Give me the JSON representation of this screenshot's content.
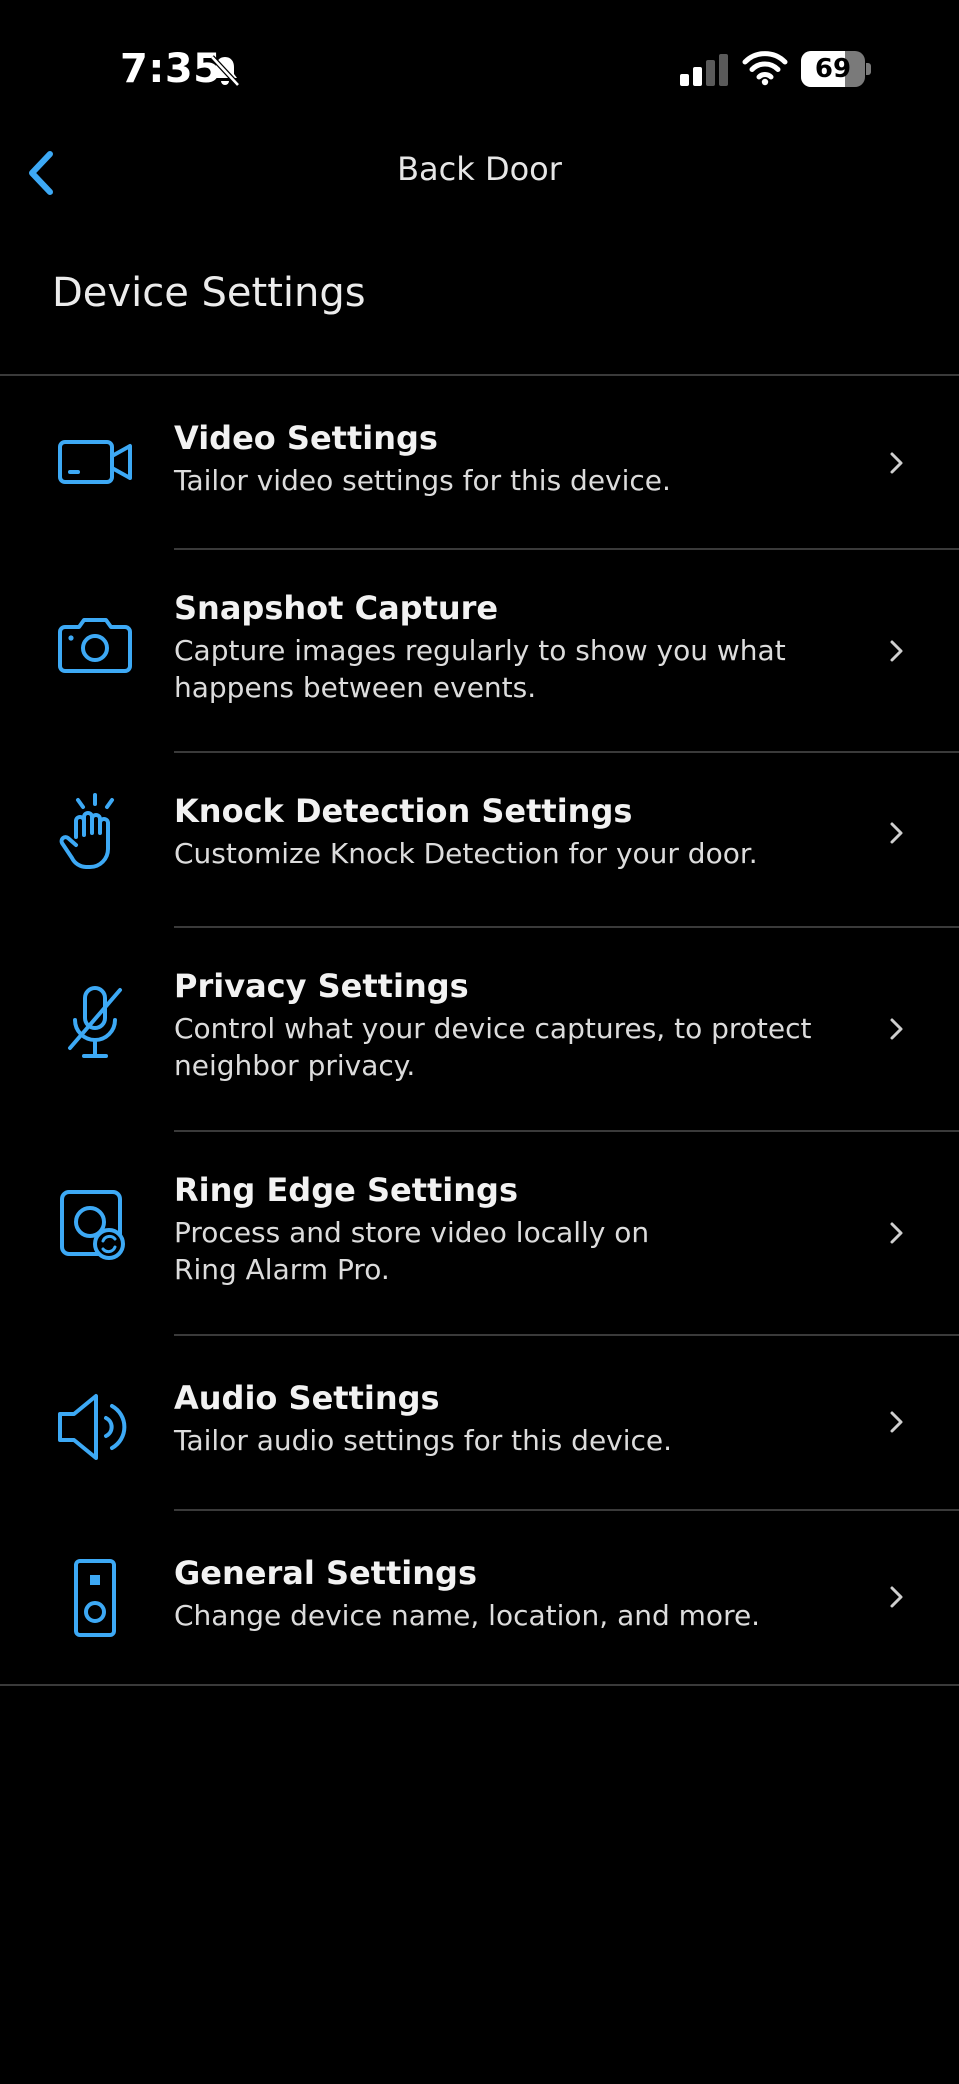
{
  "status_bar": {
    "time": "7:35",
    "battery_level": "69",
    "battery_fraction": 0.69,
    "icons": [
      "bell-slash-icon",
      "cellular-signal-icon",
      "wifi-icon",
      "battery-icon"
    ]
  },
  "nav": {
    "title": "Back Door",
    "back_icon": "chevron-left-icon"
  },
  "page": {
    "section_title": "Device Settings"
  },
  "colors": {
    "accent": "#3DA9F5",
    "background": "#000000",
    "divider": "#3a3a3a"
  },
  "settings": [
    {
      "title": "Video Settings",
      "description": "Tailor video settings for this device.",
      "icon": "video-camera-icon"
    },
    {
      "title": "Snapshot Capture",
      "description": "Capture images regularly to show you what happens between events.",
      "icon": "camera-icon"
    },
    {
      "title": "Knock Detection Settings",
      "description": "Customize Knock Detection for your door.",
      "icon": "knocking-hand-icon"
    },
    {
      "title": "Privacy Settings",
      "description": "Control what your device captures, to protect neighbor privacy.",
      "icon": "microphone-off-icon"
    },
    {
      "title": "Ring Edge Settings",
      "description": "Process and store video locally on Ring Alarm Pro.",
      "icon": "ring-edge-icon"
    },
    {
      "title": "Audio Settings",
      "description": "Tailor audio settings for this device.",
      "icon": "speaker-icon"
    },
    {
      "title": "General Settings",
      "description": "Change device name, location, and more.",
      "icon": "doorbell-device-icon"
    }
  ]
}
